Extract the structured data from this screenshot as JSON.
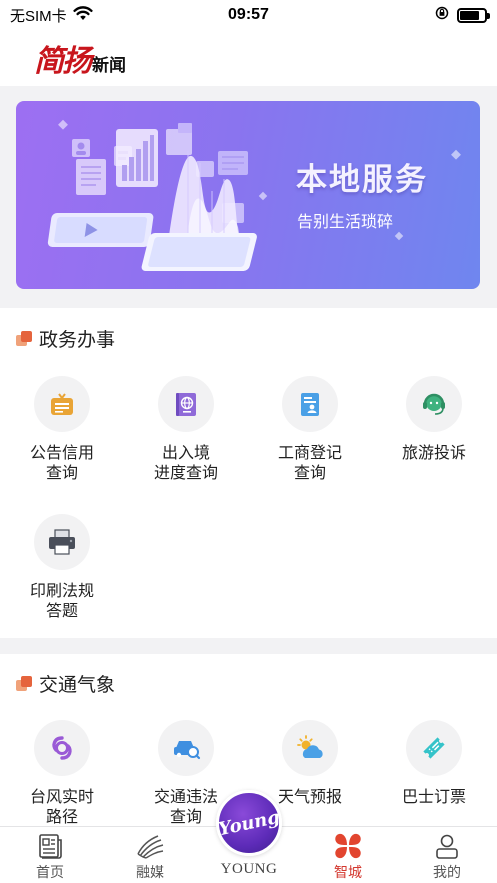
{
  "status_bar": {
    "carrier": "无SIM卡",
    "time": "09:57",
    "wifi_icon": "wifi-icon",
    "lock_icon": "orientation-lock-icon",
    "battery_icon": "battery-icon"
  },
  "header": {
    "logo_main": "简扬",
    "logo_sub": "新闻"
  },
  "banner": {
    "title": "本地服务",
    "subtitle": "告别生活琐碎"
  },
  "sections": [
    {
      "title": "政务办事",
      "items": [
        {
          "line1": "公告信用",
          "line2": "查询",
          "icon": "announcement-icon",
          "color": "#e9a435"
        },
        {
          "line1": "出入境",
          "line2": "进度查询",
          "icon": "passport-icon",
          "color": "#8f6ad8"
        },
        {
          "line1": "工商登记",
          "line2": "查询",
          "icon": "business-registration-icon",
          "color": "#4aa0e6"
        },
        {
          "line1": "旅游投诉",
          "line2": "",
          "icon": "customer-service-icon",
          "color": "#3fb27f"
        },
        {
          "line1": "印刷法规",
          "line2": "答题",
          "icon": "printer-icon",
          "color": "#4a4f5a"
        }
      ]
    },
    {
      "title": "交通气象",
      "items": [
        {
          "line1": "台风实时",
          "line2": "路径",
          "icon": "typhoon-icon",
          "color": "#9a5ad6"
        },
        {
          "line1": "交通违法",
          "line2": "查询",
          "icon": "traffic-violation-icon",
          "color": "#3f8fe0"
        },
        {
          "line1": "天气预报",
          "line2": "",
          "icon": "weather-icon",
          "color": "#f2b22a"
        },
        {
          "line1": "巴士订票",
          "line2": "",
          "icon": "bus-ticket-icon",
          "color": "#35c3c9"
        }
      ]
    }
  ],
  "tab_bar": {
    "tabs": [
      {
        "label": "首页",
        "icon": "newspaper-icon"
      },
      {
        "label": "融媒",
        "icon": "media-icon"
      },
      {
        "label": "YOUNG",
        "icon": "young-logo-icon",
        "badge_text": "Young"
      },
      {
        "label": "智城",
        "icon": "smart-city-icon",
        "active": true
      },
      {
        "label": "我的",
        "icon": "profile-icon"
      }
    ]
  },
  "colors": {
    "brand_red": "#c8161d",
    "active_tab": "#d3382f",
    "banner_start": "#9d6ff2",
    "banner_end": "#6f86ef"
  }
}
